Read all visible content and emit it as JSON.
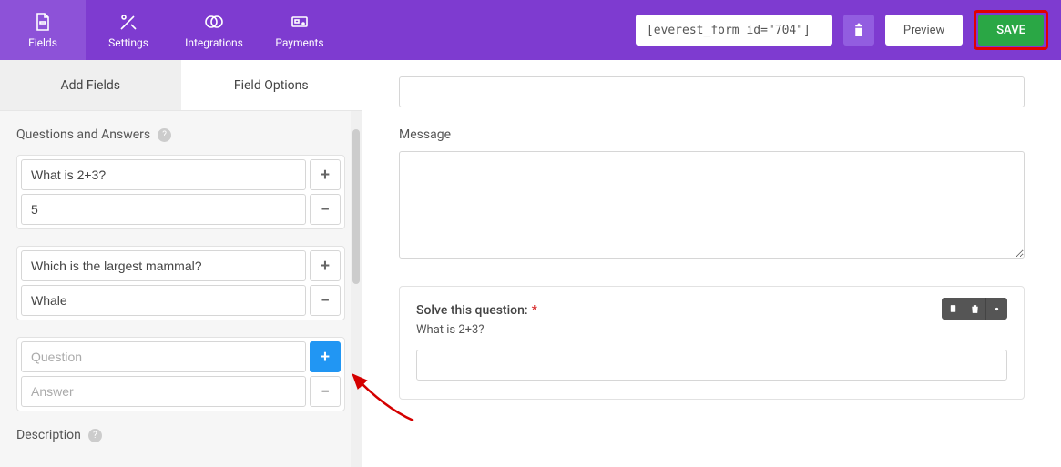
{
  "nav": {
    "fields": "Fields",
    "settings": "Settings",
    "integrations": "Integrations",
    "payments": "Payments"
  },
  "topbar": {
    "shortcode": "[everest_form id=\"704\"]",
    "preview": "Preview",
    "save": "SAVE"
  },
  "tabs": {
    "add_fields": "Add Fields",
    "field_options": "Field Options"
  },
  "sidebar": {
    "section_title": "Questions and Answers",
    "qa": [
      {
        "q": "What is 2+3?",
        "a": "5"
      },
      {
        "q": "Which is the largest mammal?",
        "a": "Whale"
      },
      {
        "q": "",
        "a": ""
      }
    ],
    "placeholders": {
      "q": "Question",
      "a": "Answer"
    },
    "description_title": "Description"
  },
  "canvas": {
    "message_label": "Message",
    "captcha_label": "Solve this question:",
    "captcha_question": "What is 2+3?"
  }
}
